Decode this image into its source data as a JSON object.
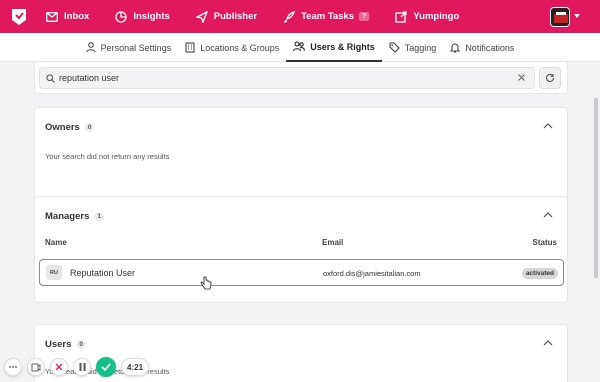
{
  "topnav": {
    "items": [
      {
        "label": "Inbox",
        "icon": "mail-icon"
      },
      {
        "label": "Insights",
        "icon": "pie-chart-icon"
      },
      {
        "label": "Publisher",
        "icon": "send-icon"
      },
      {
        "label": "Team Tasks",
        "icon": "rocket-icon",
        "badge": "?"
      },
      {
        "label": "Yumpingo",
        "icon": "external-link-icon"
      }
    ],
    "brand_color": "#e0185d"
  },
  "subnav": {
    "tabs": [
      {
        "label": "Personal Settings",
        "icon": "person-icon"
      },
      {
        "label": "Locations & Groups",
        "icon": "building-icon"
      },
      {
        "label": "Users & Rights",
        "icon": "users-icon",
        "active": true
      },
      {
        "label": "Tagging",
        "icon": "tag-icon"
      },
      {
        "label": "Notifications",
        "icon": "bell-icon"
      }
    ]
  },
  "search": {
    "value": "reputation user"
  },
  "owners": {
    "title": "Owners",
    "count": "0",
    "empty_message": "Your search did not return any results"
  },
  "managers": {
    "title": "Managers",
    "count": "1",
    "columns": {
      "name": "Name",
      "email": "Email",
      "status": "Status"
    },
    "rows": [
      {
        "initials": "RU",
        "name": "Reputation User",
        "email": "oxford.dis@jamiesitalian.com",
        "status": "activated"
      }
    ]
  },
  "users": {
    "title": "Users",
    "count": "0",
    "empty_message": "Your search did not return any results"
  },
  "recorder": {
    "timer": "4:21",
    "accent": "#17c08b"
  }
}
